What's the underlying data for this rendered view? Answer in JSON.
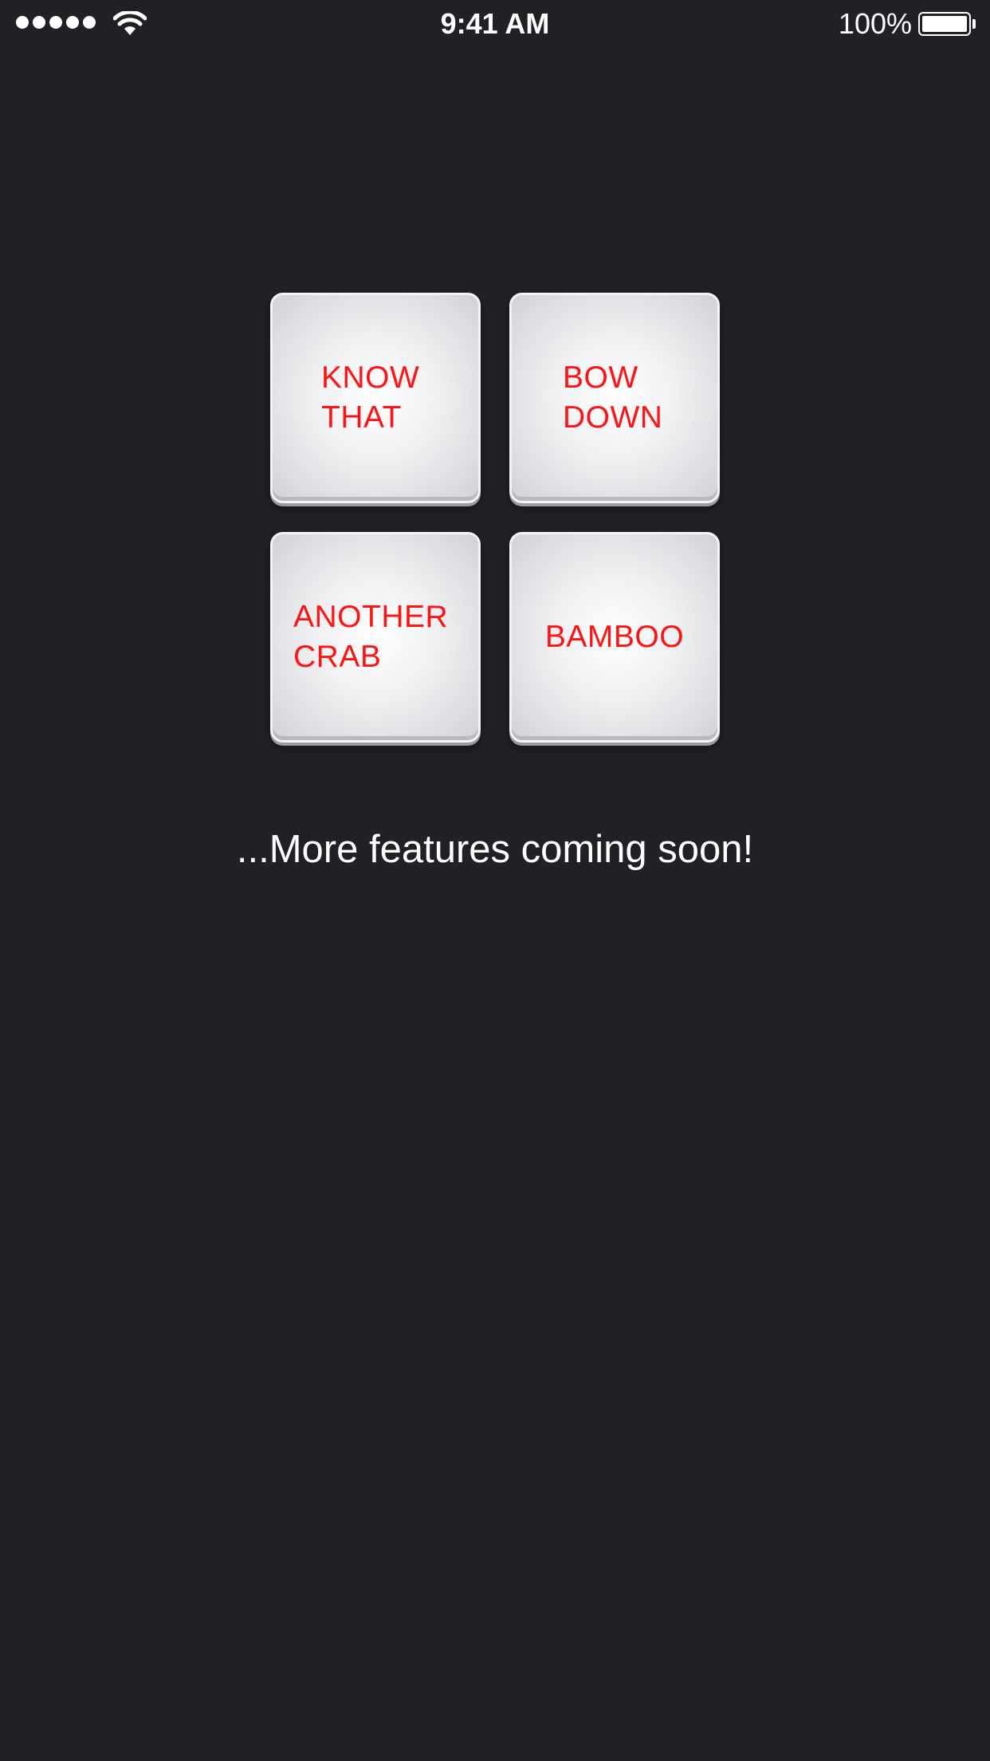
{
  "status_bar": {
    "time": "9:41 AM",
    "battery_percent": "100%",
    "signal_bars": 5,
    "wifi_icon": "wifi-icon",
    "battery_icon": "battery-icon",
    "battery_level": 1.0
  },
  "tiles": [
    {
      "line1": "KNOW",
      "line2": "THAT"
    },
    {
      "line1": "BOW",
      "line2": "DOWN"
    },
    {
      "line1": "ANOTHER",
      "line2": "CRAB"
    },
    {
      "line1": "BAMBOO",
      "line2": ""
    }
  ],
  "footer": {
    "message": "...More features coming soon!"
  },
  "colors": {
    "background": "#202125",
    "tile_text": "#ff1414",
    "tile_face": "#eeeff1",
    "status_text": "#ffffff"
  }
}
